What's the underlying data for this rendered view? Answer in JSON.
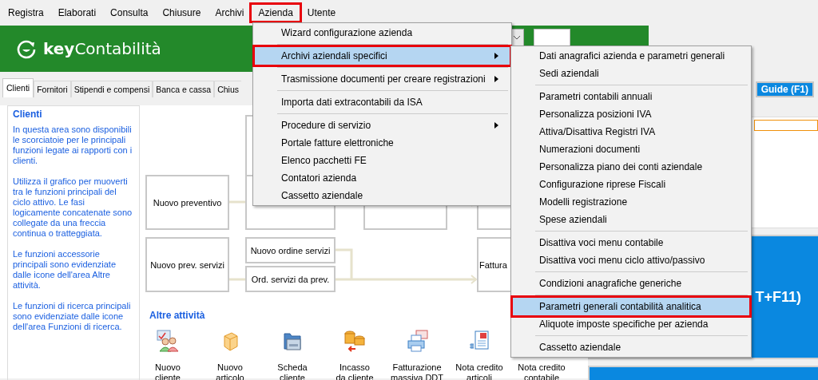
{
  "menubar": [
    {
      "label": "Registra",
      "highlighted": false
    },
    {
      "label": "Elaborati",
      "highlighted": false
    },
    {
      "label": "Consulta",
      "highlighted": false
    },
    {
      "label": "Chiusure",
      "highlighted": false
    },
    {
      "label": "Archivi",
      "highlighted": false
    },
    {
      "label": "Azienda",
      "highlighted": true
    },
    {
      "label": "Utente",
      "highlighted": false
    }
  ],
  "header": {
    "logo_bold": "key",
    "logo_rest": "Contabilità"
  },
  "tabs": [
    {
      "label": "Clienti",
      "selected": true
    },
    {
      "label": "Fornitori",
      "selected": false
    },
    {
      "label": "Stipendi e compensi",
      "selected": false
    },
    {
      "label": "Banca e cassa",
      "selected": false
    },
    {
      "label": "Chius",
      "selected": false
    }
  ],
  "guide_button": "Guide (F1)",
  "info_panel": {
    "title": "Clienti",
    "paragraphs": [
      "In questa area sono disponibili le scorciatoie per le principali funzioni legate ai rapporti con i clienti.",
      "Utilizza il grafico per muoverti tra le funzioni principali del ciclo attivo. Le fasi logicamente concatenate sono collegate da una freccia continua o tratteggiata.",
      "Le funzioni accessorie principali sono evidenziate dalle icone dell'area Altre attività.",
      "Le funzioni di ricerca principali sono evidenziate dalle icone dell'area Funzioni di ricerca."
    ]
  },
  "diagram": {
    "nodes": [
      {
        "label": "Nuovo preventivo"
      },
      {
        "label": "Nuovo prev. servizi"
      },
      {
        "label": "Nuovo ordine servizi"
      },
      {
        "label": "Ord. servizi da prev."
      },
      {
        "label": "Fattura"
      }
    ]
  },
  "other_activities": {
    "title": "Altre attività",
    "items": [
      {
        "lines": [
          "Nuovo",
          "cliente"
        ]
      },
      {
        "lines": [
          "Nuovo",
          "articolo"
        ]
      },
      {
        "lines": [
          "Scheda",
          "cliente"
        ]
      },
      {
        "lines": [
          "Incasso",
          "da cliente"
        ]
      },
      {
        "lines": [
          "Fatturazione",
          "massiva DDT"
        ]
      },
      {
        "lines": [
          "Nota credito",
          "articoli"
        ]
      },
      {
        "lines": [
          "Nota credito",
          "contabile"
        ]
      }
    ]
  },
  "tile": {
    "text": "T+F11)"
  },
  "menu": {
    "items": [
      {
        "kind": "item",
        "label": "Wizard configurazione azienda",
        "submenu": false,
        "selected": false,
        "highlighted": false
      },
      {
        "kind": "separator"
      },
      {
        "kind": "item",
        "label": "Archivi aziendali specifici",
        "submenu": true,
        "selected": true,
        "highlighted": true
      },
      {
        "kind": "separator"
      },
      {
        "kind": "item",
        "label": "Trasmissione documenti per creare registrazioni",
        "submenu": true,
        "selected": false,
        "highlighted": false
      },
      {
        "kind": "separator"
      },
      {
        "kind": "item",
        "label": "Importa dati extracontabili da ISA",
        "submenu": false,
        "selected": false,
        "highlighted": false
      },
      {
        "kind": "separator"
      },
      {
        "kind": "item",
        "label": "Procedure di servizio",
        "submenu": true,
        "selected": false,
        "highlighted": false
      },
      {
        "kind": "item",
        "label": "Portale fatture elettroniche",
        "submenu": false,
        "selected": false,
        "highlighted": false
      },
      {
        "kind": "item",
        "label": "Elenco pacchetti FE",
        "submenu": false,
        "selected": false,
        "highlighted": false
      },
      {
        "kind": "item",
        "label": "Contatori azienda",
        "submenu": false,
        "selected": false,
        "highlighted": false
      },
      {
        "kind": "item",
        "label": "Cassetto aziendale",
        "submenu": false,
        "selected": false,
        "highlighted": false
      }
    ]
  },
  "submenu": {
    "items": [
      {
        "kind": "item",
        "label": "Dati anagrafici azienda e parametri generali",
        "selected": false,
        "highlighted": false
      },
      {
        "kind": "item",
        "label": "Sedi aziendali",
        "selected": false,
        "highlighted": false
      },
      {
        "kind": "separator"
      },
      {
        "kind": "item",
        "label": "Parametri contabili annuali",
        "selected": false,
        "highlighted": false
      },
      {
        "kind": "item",
        "label": "Personalizza posizioni IVA",
        "selected": false,
        "highlighted": false
      },
      {
        "kind": "item",
        "label": "Attiva/Disattiva Registri IVA",
        "selected": false,
        "highlighted": false
      },
      {
        "kind": "item",
        "label": "Numerazioni documenti",
        "selected": false,
        "highlighted": false
      },
      {
        "kind": "item",
        "label": "Personalizza piano dei conti aziendale",
        "selected": false,
        "highlighted": false
      },
      {
        "kind": "item",
        "label": "Configurazione riprese Fiscali",
        "selected": false,
        "highlighted": false
      },
      {
        "kind": "item",
        "label": "Modelli registrazione",
        "selected": false,
        "highlighted": false
      },
      {
        "kind": "item",
        "label": "Spese aziendali",
        "selected": false,
        "highlighted": false
      },
      {
        "kind": "separator"
      },
      {
        "kind": "item",
        "label": "Disattiva voci menu contabile",
        "selected": false,
        "highlighted": false
      },
      {
        "kind": "item",
        "label": "Disattiva voci menu ciclo attivo/passivo",
        "selected": false,
        "highlighted": false
      },
      {
        "kind": "separator"
      },
      {
        "kind": "item",
        "label": "Condizioni anagrafiche generiche",
        "selected": false,
        "highlighted": false
      },
      {
        "kind": "separator"
      },
      {
        "kind": "item",
        "label": "Parametri generali contabilità analitica",
        "selected": true,
        "highlighted": true
      },
      {
        "kind": "item",
        "label": "Aliquote imposte specifiche per azienda",
        "selected": false,
        "highlighted": false
      },
      {
        "kind": "separator"
      },
      {
        "kind": "item",
        "label": "Cassetto aziendale",
        "selected": false,
        "highlighted": false
      }
    ]
  }
}
